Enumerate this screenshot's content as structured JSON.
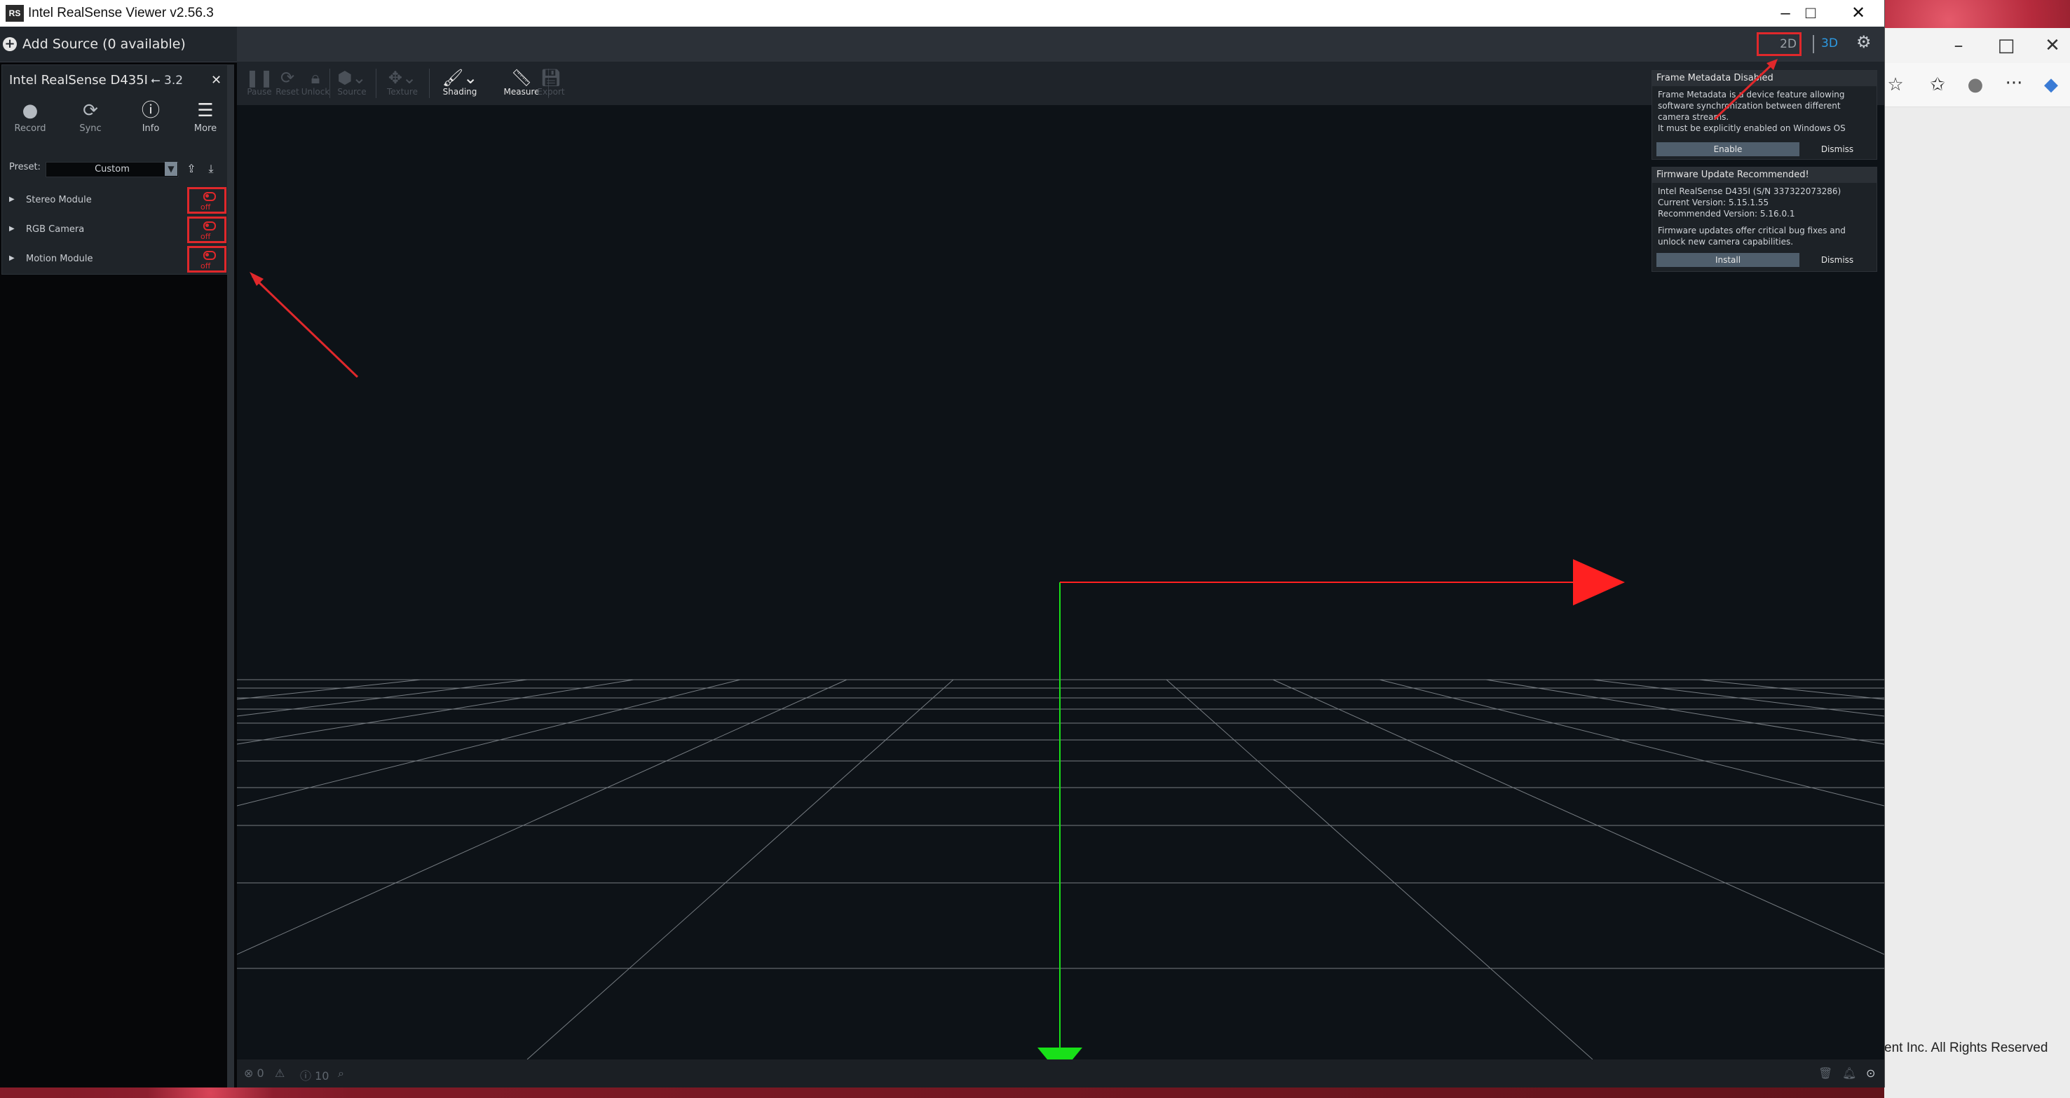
{
  "window": {
    "title": "Intel RealSense Viewer v2.56.3",
    "app_icon_text": "RS"
  },
  "left_panel": {
    "add_source_label": "Add Source (0 available)",
    "device": {
      "name": "Intel RealSense D435I",
      "usb_label": "3.2",
      "buttons": [
        {
          "label": "Record",
          "icon": "record-icon"
        },
        {
          "label": "Sync",
          "icon": "sync-icon"
        },
        {
          "label": "Info",
          "icon": "info-icon"
        },
        {
          "label": "More",
          "icon": "menu-icon"
        }
      ],
      "preset_label": "Preset:",
      "preset_value": "Custom",
      "modules": [
        {
          "name": "Stereo Module",
          "state": "off"
        },
        {
          "name": "RGB Camera",
          "state": "off"
        },
        {
          "name": "Motion Module",
          "state": "off"
        }
      ]
    }
  },
  "view": {
    "mode_2d": "2D",
    "mode_3d": "3D",
    "tools": [
      {
        "label": "Pause",
        "icon": "pause-icon",
        "active": false
      },
      {
        "label": "Reset",
        "icon": "reset-icon",
        "active": false
      },
      {
        "label": "Unlock",
        "icon": "lock-icon",
        "active": false
      },
      {
        "label": "Source",
        "icon": "cube-icon",
        "active": false
      },
      {
        "label": "Texture",
        "icon": "texture-icon",
        "active": false
      },
      {
        "label": "Shading",
        "icon": "paint-roller-icon",
        "active": true
      },
      {
        "label": "Measure",
        "icon": "ruler-icon",
        "active": true
      },
      {
        "label": "Export",
        "icon": "save-icon",
        "active": false
      }
    ]
  },
  "notifications": [
    {
      "title": "Frame Metadata Disabled",
      "body_lines": [
        "Frame Metadata is a device feature allowing",
        "software synchronization between different",
        "camera streams.",
        "It must be explicitly enabled on Windows OS"
      ],
      "primary_button": "Enable",
      "secondary_button": "Dismiss"
    },
    {
      "title": "Firmware Update Recommended!",
      "body_lines": [
        "Intel RealSense D435I     (S/N 337322073286)",
        "Current Version: 5.15.1.55",
        "Recommended Version: 5.16.0.1",
        "",
        "Firmware updates offer critical bug fixes and",
        "unlock new camera capabilities."
      ],
      "primary_button": "Install",
      "secondary_button": "Dismiss"
    }
  ],
  "status_bar": {
    "errors": "0",
    "warnings": "",
    "info": "10"
  },
  "background_browser": {
    "footer_text": "ent Inc. All Rights Reserved"
  },
  "colors": {
    "annotation_red": "#e0282b",
    "accent_blue": "#2d9ae3",
    "axis_green": "#18e018",
    "axis_red": "#ff2020"
  }
}
